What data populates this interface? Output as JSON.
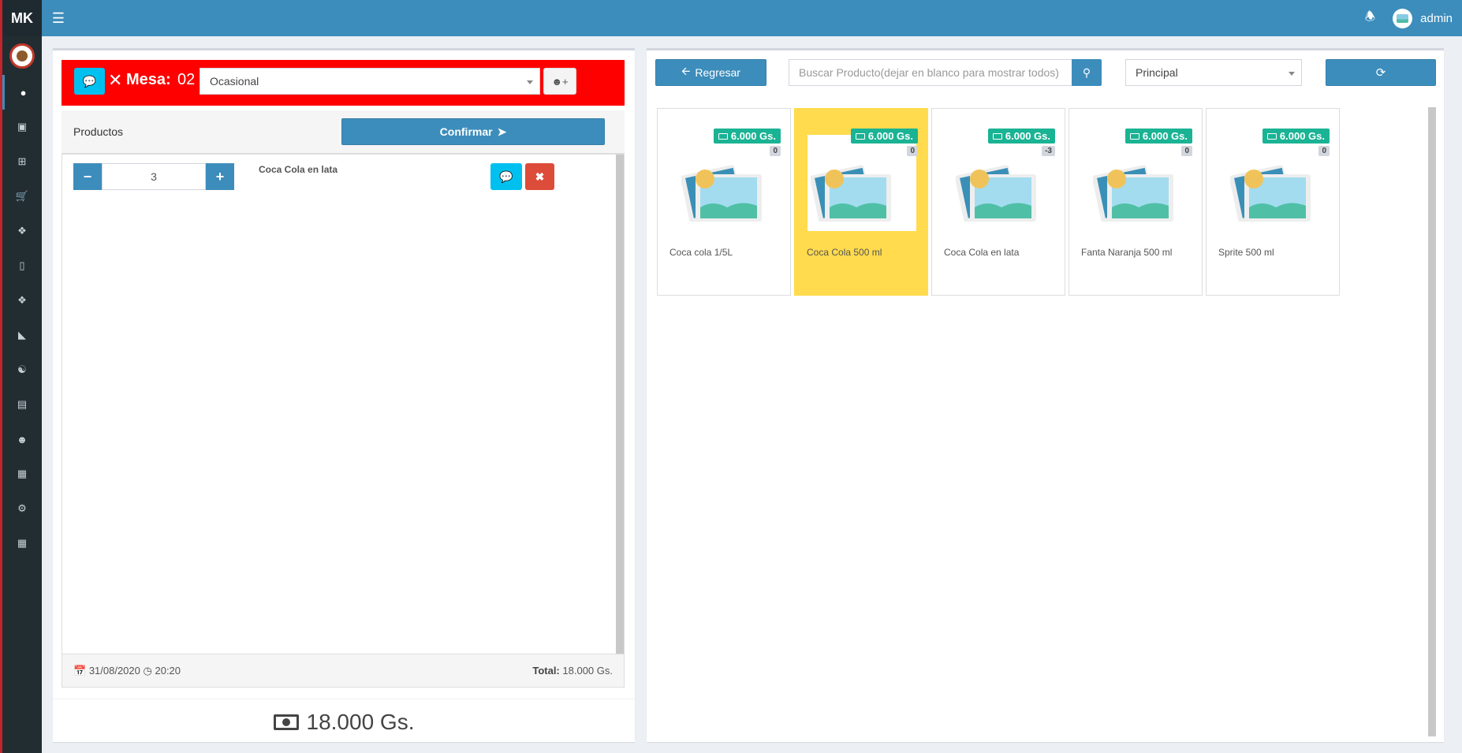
{
  "brand": "MK",
  "user": {
    "name": "admin"
  },
  "sidebar": {
    "icons": [
      "user-icon",
      "money-icon",
      "plus-square-icon",
      "cart-icon",
      "cubes-icon",
      "barcode-icon",
      "cubes-alt-icon",
      "chart-icon",
      "male-icon",
      "archive-icon",
      "users-icon",
      "building-icon",
      "cogs-icon",
      "table-icon"
    ]
  },
  "order": {
    "mesa_label": "Mesa:",
    "mesa_number": "02",
    "client": "Ocasional",
    "products_title": "Productos",
    "confirm_label": "Confirmar",
    "items": [
      {
        "quantity": "3",
        "name": "Coca Cola en lata"
      }
    ],
    "date": "31/08/2020",
    "time": "20:20",
    "total_label": "Total:",
    "total_value": "18.000 Gs.",
    "big_total": "18.000 Gs."
  },
  "catalog": {
    "back_label": "Regresar",
    "search_placeholder": "Buscar Producto(dejar en blanco para mostrar todos)",
    "search_value": "",
    "category": "Principal",
    "products": [
      {
        "name": "Coca cola 1/5L",
        "price": "6.000 Gs.",
        "stock": "0",
        "selected": false
      },
      {
        "name": "Coca Cola 500 ml",
        "price": "6.000 Gs.",
        "stock": "0",
        "selected": true
      },
      {
        "name": "Coca Cola en lata",
        "price": "6.000 Gs.",
        "stock": "-3",
        "selected": false
      },
      {
        "name": "Fanta Naranja 500 ml",
        "price": "6.000 Gs.",
        "stock": "0",
        "selected": false
      },
      {
        "name": "Sprite 500 ml",
        "price": "6.000 Gs.",
        "stock": "0",
        "selected": false
      }
    ]
  },
  "colors": {
    "primary": "#3c8dbc",
    "mesa_bar": "#ff0000",
    "info": "#00c0ef",
    "danger": "#dd4b39",
    "price_tag": "#1ab394",
    "selected_card": "#ffdb4d"
  }
}
